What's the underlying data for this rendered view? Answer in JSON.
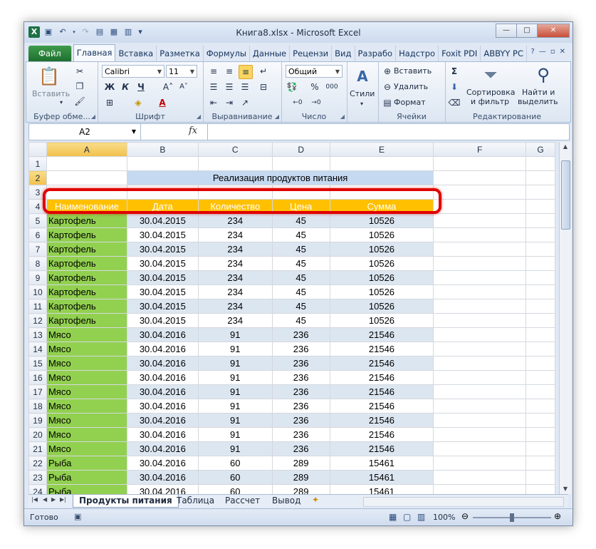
{
  "window": {
    "title": "Книга8.xlsx - Microsoft Excel",
    "buttons": {
      "minimize": "—",
      "maximize": "□",
      "close": "✕"
    }
  },
  "ribbon": {
    "tabs": [
      "Файл",
      "Главная",
      "Вставка",
      "Разметка",
      "Формулы",
      "Данные",
      "Рецензи",
      "Вид",
      "Разрабо",
      "Надстро",
      "Foxit PDI",
      "ABBYY PC"
    ],
    "active_tab": "Главная",
    "groups": {
      "clipboard": {
        "label": "Буфер обме...",
        "paste": "Вставить"
      },
      "font": {
        "label": "Шрифт",
        "font_name": "Calibri",
        "font_size": "11",
        "bold": "Ж",
        "italic": "К",
        "underline": "Ч"
      },
      "alignment": {
        "label": "Выравнивание"
      },
      "number": {
        "label": "Число",
        "format": "Общий",
        "percent": "%",
        "thousands": "000"
      },
      "styles": {
        "label": "Стили"
      },
      "cells": {
        "label": "Ячейки",
        "insert": "Вставить",
        "delete": "Удалить",
        "format": "Формат"
      },
      "editing": {
        "label": "Редактирование",
        "sort_filter_1": "Сортировка",
        "sort_filter_2": "и фильтр",
        "find_1": "Найти и",
        "find_2": "выделить"
      }
    }
  },
  "formula_bar": {
    "name_box": "A2",
    "fx": "fx",
    "content": ""
  },
  "sheet": {
    "columns": [
      "A",
      "B",
      "C",
      "D",
      "E",
      "F",
      "G"
    ],
    "selected_column": "A",
    "selected_row": "2",
    "title": "Реализация продуктов питания",
    "headers": [
      "Наименование",
      "Дата",
      "Количество",
      "Цена",
      "Сумма"
    ],
    "rows": [
      {
        "n": "5",
        "name": "Картофель",
        "date": "30.04.2015",
        "qty": "234",
        "price": "45",
        "sum": "10526"
      },
      {
        "n": "6",
        "name": "Картофель",
        "date": "30.04.2015",
        "qty": "234",
        "price": "45",
        "sum": "10526"
      },
      {
        "n": "7",
        "name": "Картофель",
        "date": "30.04.2015",
        "qty": "234",
        "price": "45",
        "sum": "10526"
      },
      {
        "n": "8",
        "name": "Картофель",
        "date": "30.04.2015",
        "qty": "234",
        "price": "45",
        "sum": "10526"
      },
      {
        "n": "9",
        "name": "Картофель",
        "date": "30.04.2015",
        "qty": "234",
        "price": "45",
        "sum": "10526"
      },
      {
        "n": "10",
        "name": "Картофель",
        "date": "30.04.2015",
        "qty": "234",
        "price": "45",
        "sum": "10526"
      },
      {
        "n": "11",
        "name": "Картофель",
        "date": "30.04.2015",
        "qty": "234",
        "price": "45",
        "sum": "10526"
      },
      {
        "n": "12",
        "name": "Картофель",
        "date": "30.04.2015",
        "qty": "234",
        "price": "45",
        "sum": "10526"
      },
      {
        "n": "13",
        "name": "Мясо",
        "date": "30.04.2016",
        "qty": "91",
        "price": "236",
        "sum": "21546"
      },
      {
        "n": "14",
        "name": "Мясо",
        "date": "30.04.2016",
        "qty": "91",
        "price": "236",
        "sum": "21546"
      },
      {
        "n": "15",
        "name": "Мясо",
        "date": "30.04.2016",
        "qty": "91",
        "price": "236",
        "sum": "21546"
      },
      {
        "n": "16",
        "name": "Мясо",
        "date": "30.04.2016",
        "qty": "91",
        "price": "236",
        "sum": "21546"
      },
      {
        "n": "17",
        "name": "Мясо",
        "date": "30.04.2016",
        "qty": "91",
        "price": "236",
        "sum": "21546"
      },
      {
        "n": "18",
        "name": "Мясо",
        "date": "30.04.2016",
        "qty": "91",
        "price": "236",
        "sum": "21546"
      },
      {
        "n": "19",
        "name": "Мясо",
        "date": "30.04.2016",
        "qty": "91",
        "price": "236",
        "sum": "21546"
      },
      {
        "n": "20",
        "name": "Мясо",
        "date": "30.04.2016",
        "qty": "91",
        "price": "236",
        "sum": "21546"
      },
      {
        "n": "21",
        "name": "Мясо",
        "date": "30.04.2016",
        "qty": "91",
        "price": "236",
        "sum": "21546"
      },
      {
        "n": "22",
        "name": "Рыба",
        "date": "30.04.2016",
        "qty": "60",
        "price": "289",
        "sum": "15461"
      },
      {
        "n": "23",
        "name": "Рыба",
        "date": "30.04.2016",
        "qty": "60",
        "price": "289",
        "sum": "15461"
      },
      {
        "n": "24",
        "name": "Рыба",
        "date": "30.04.2016",
        "qty": "60",
        "price": "289",
        "sum": "15461"
      }
    ]
  },
  "sheet_tabs": [
    "Продукты питания",
    "Таблица",
    "Рассчет",
    "Вывод"
  ],
  "active_sheet": "Продукты питания",
  "status": {
    "mode": "Готово",
    "zoom": "100%"
  },
  "accent": {
    "header_fill": "#ffc000",
    "name_fill": "#92d050",
    "title_fill": "#c5d9f1",
    "highlight": "#e00000"
  }
}
